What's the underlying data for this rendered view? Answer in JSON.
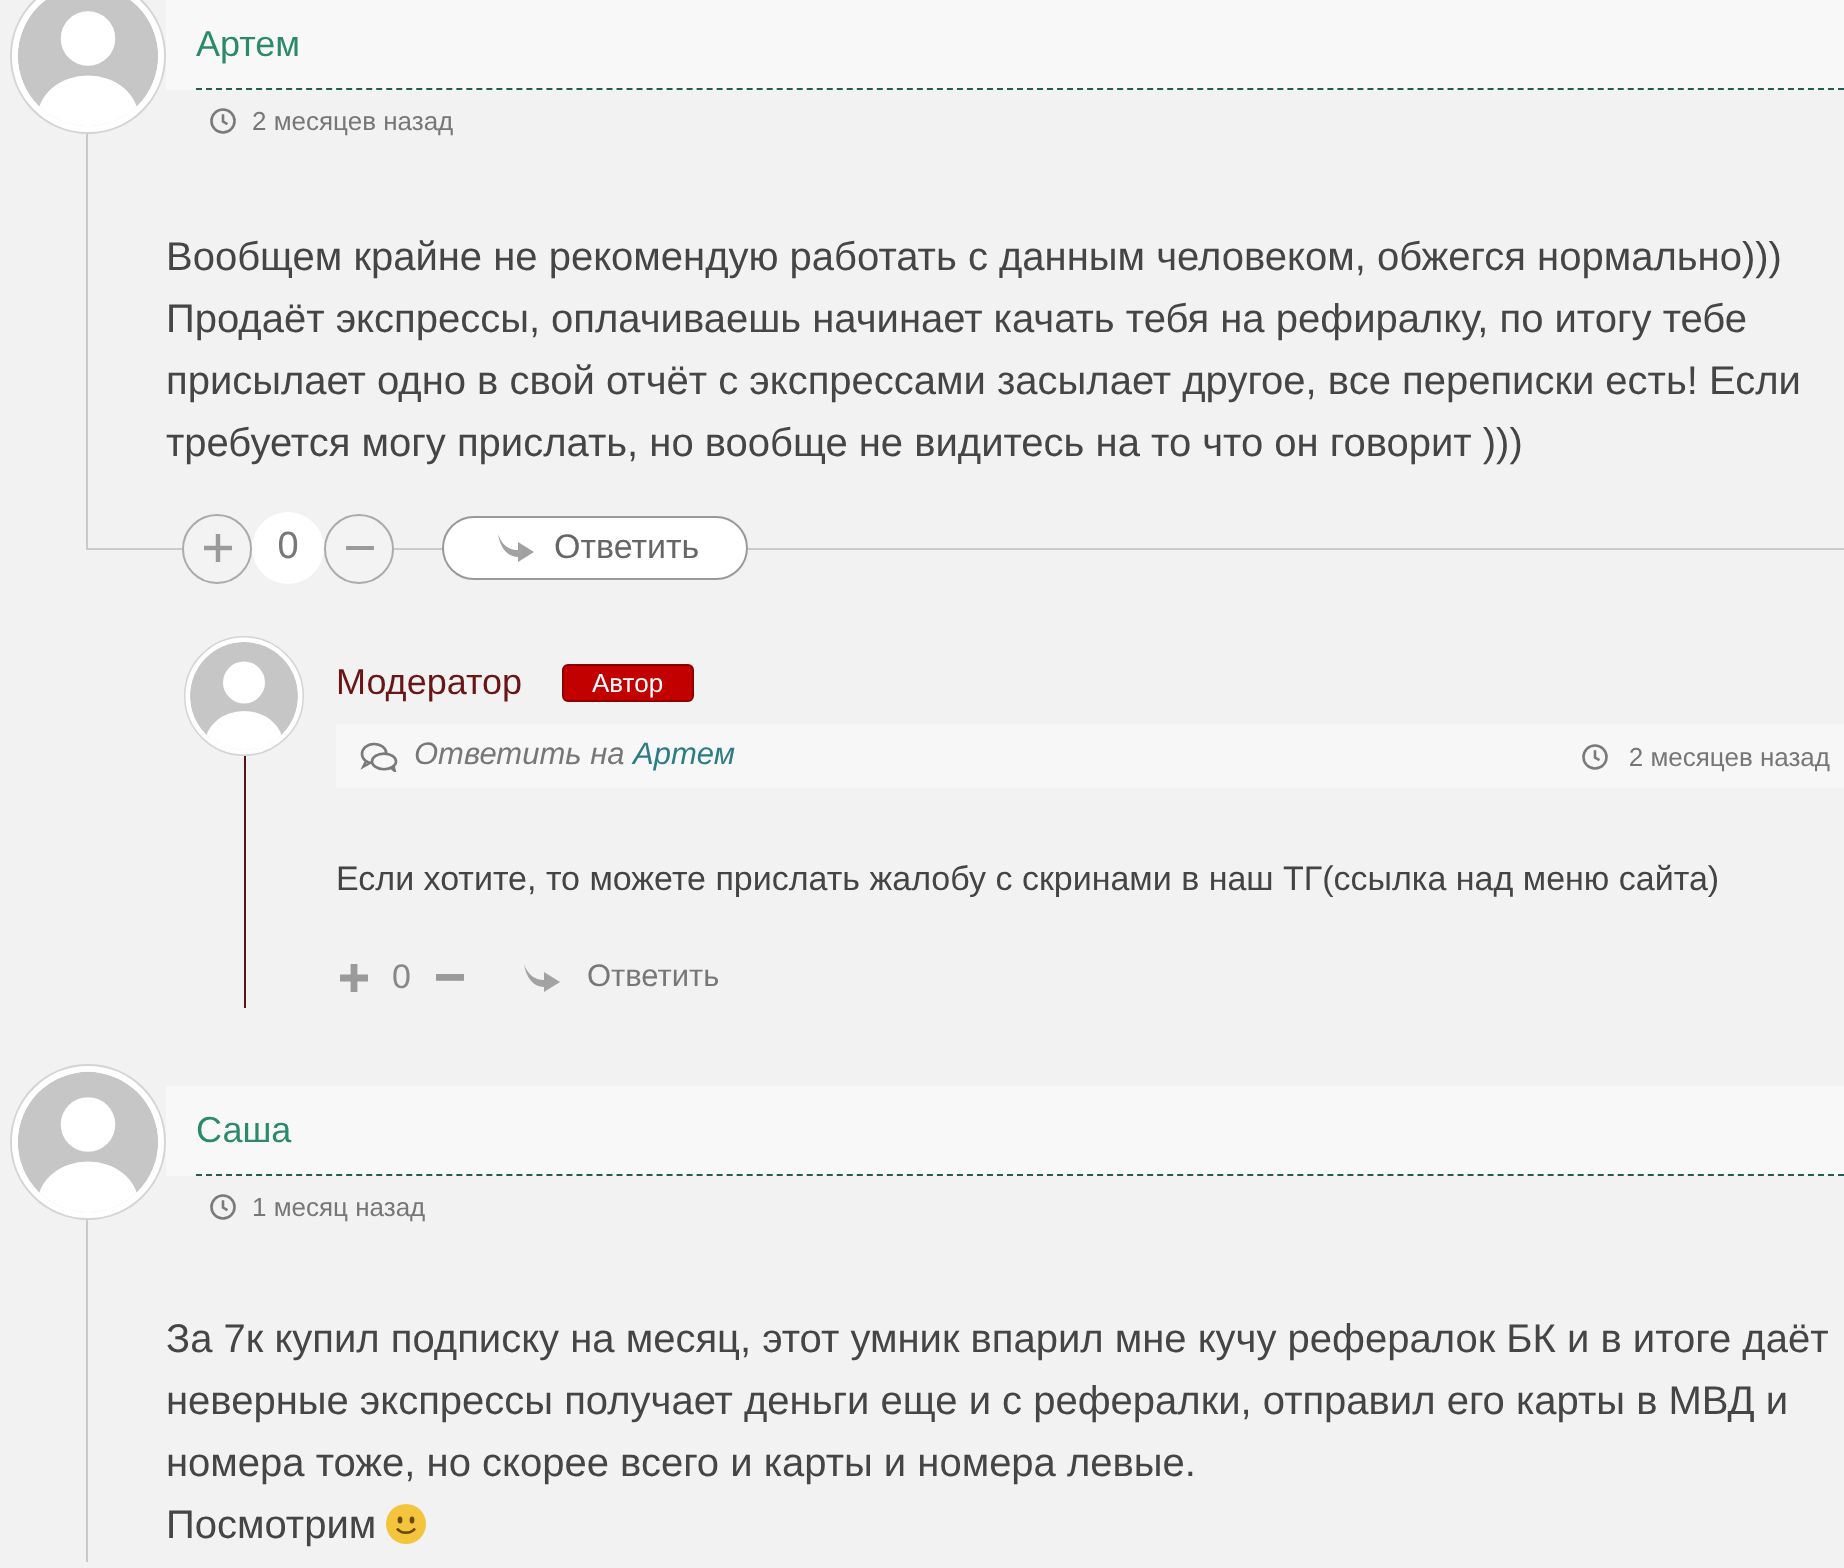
{
  "comments": [
    {
      "kind": "reader",
      "author": "Артем",
      "time": "2 месяцев назад",
      "body": [
        "Вообщем крайне не рекомендую работать с данным человеком, обжегся нормально))) Продаёт экспрессы, оплачиваешь начинает качать тебя на рефиралку, по итогу тебе присылает одно в свой отчёт с экспрессами засылает другое, все переписки есть! Если требуется могу прислать, но вообще не видитесь на то что он говорит )))"
      ],
      "votes": "0",
      "reply_label": "Ответить",
      "children": [
        {
          "kind": "author",
          "author": "Модератор",
          "badge": "Автор",
          "reply_to": {
            "label": "Ответить на",
            "name": "Артем"
          },
          "time": "2 месяцев назад",
          "body": [
            "Если хотите, то можете прислать жалобу с скринами в наш ТГ(ссылка над меню сайта)"
          ],
          "votes": "0",
          "reply_label": "Ответить"
        }
      ]
    },
    {
      "kind": "reader",
      "author": "Саша",
      "time": "1 месяц назад",
      "body": [
        "За 7к купил подписку на месяц, этот умник впарил мне кучу рефералок БК и в итоге даёт неверные экспрессы получает деньги еще и с рефералки, отправил его карты в МВД и номера тоже, но скорее всего и карты и номера левые.",
        "Посмотрим"
      ],
      "smiley": true
    }
  ]
}
